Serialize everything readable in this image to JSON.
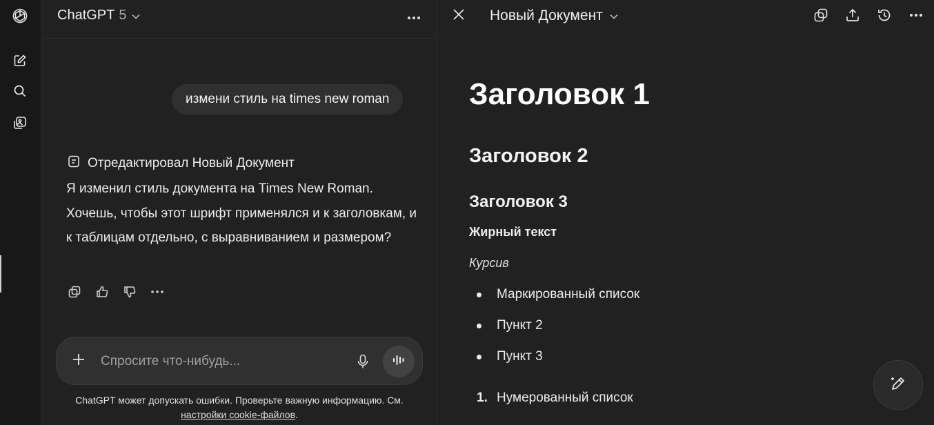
{
  "chat": {
    "model": "ChatGPT",
    "model_version": "5",
    "user_message": "измени стиль на times new roman",
    "edit_note": "Отредактировал Новый Документ",
    "assistant_message": "Я изменил стиль документа на Times New Roman. Хочешь, чтобы этот шрифт применялся и к заголовкам, и к таблицам отдельно, с выравниванием и размером?",
    "composer_placeholder": "Спросите что-нибудь...",
    "disclaimer_text": "ChatGPT может допускать ошибки. Проверьте важную информацию. См. ",
    "disclaimer_link": "настройки cookie-файлов",
    "disclaimer_end": "."
  },
  "document": {
    "title": "Новый Документ",
    "heading1": "Заголовок 1",
    "heading2": "Заголовок 2",
    "heading3": "Заголовок 3",
    "bold_text": "Жирный текст",
    "italic_text": "Курсив",
    "bullets": [
      "Маркированный список",
      "Пункт 2",
      "Пункт 3"
    ],
    "numbered": [
      {
        "marker": "1.",
        "text": "Нумерованный список"
      }
    ]
  },
  "icons": {
    "rail": [
      "openai-logo-icon",
      "new-chat-icon",
      "search-icon",
      "library-icon"
    ],
    "message_actions": [
      "copy-icon",
      "thumbs-up-icon",
      "thumbs-down-icon",
      "more-icon"
    ],
    "doc_tools": [
      "copy-icon",
      "share-icon",
      "history-icon",
      "more-icon"
    ]
  },
  "colors": {
    "background": "#212121",
    "rail": "#181818",
    "bubble": "#303030",
    "text": "#ececec"
  }
}
